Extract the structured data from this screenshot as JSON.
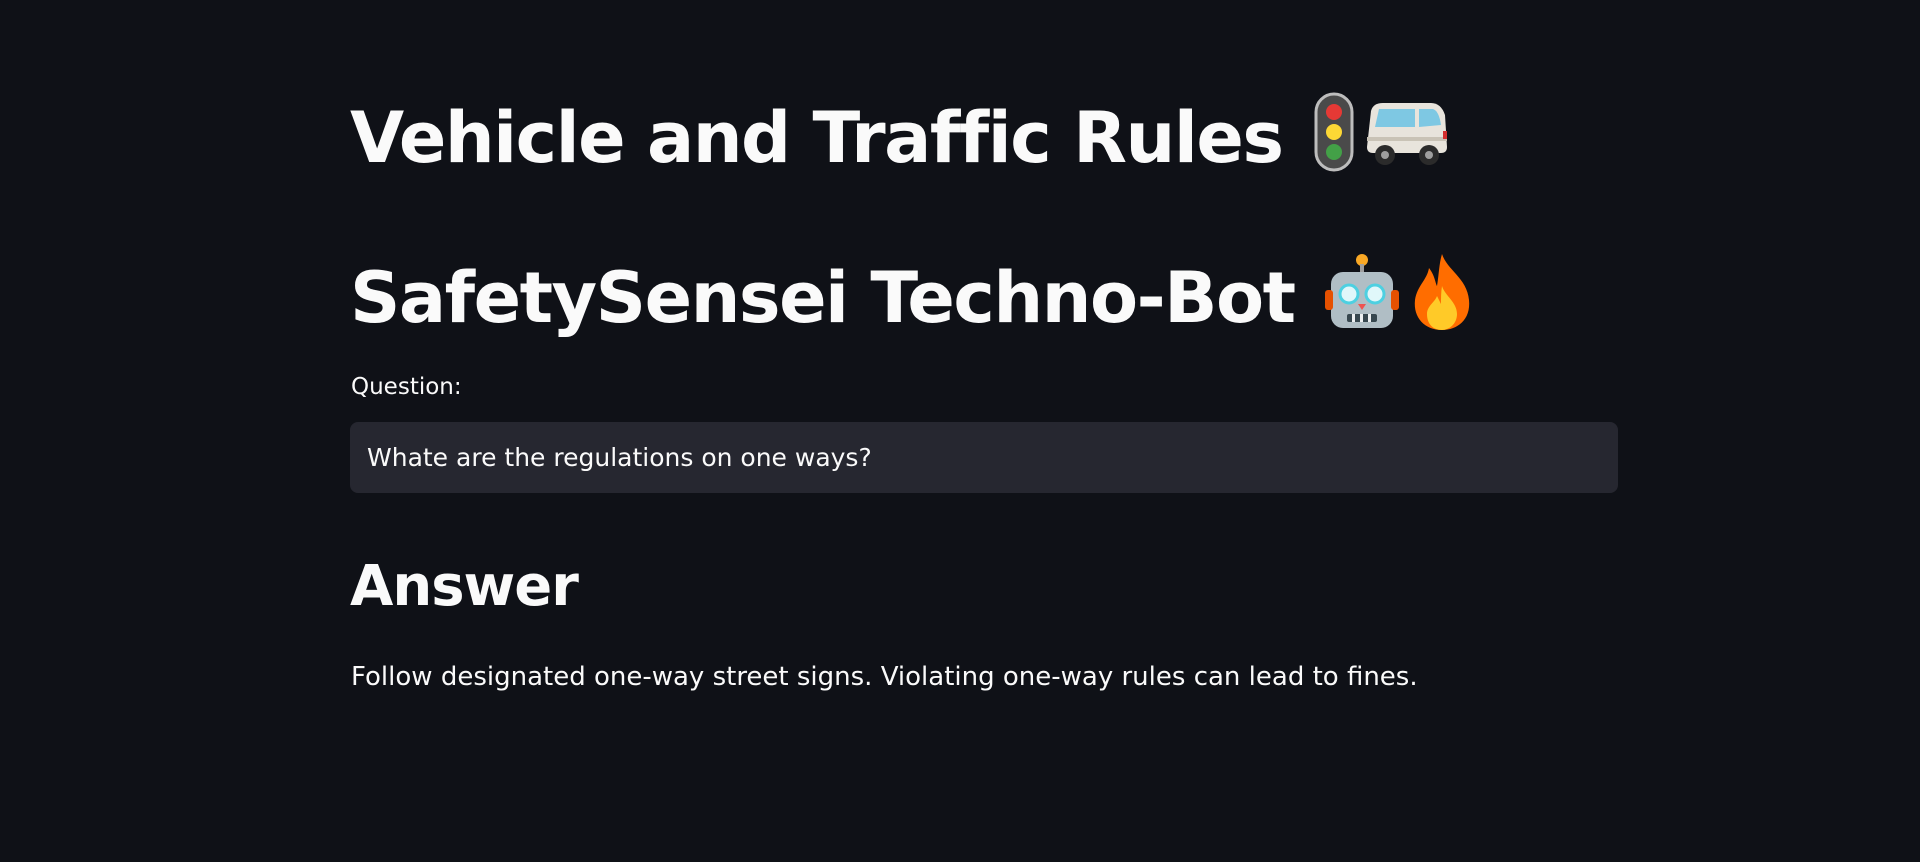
{
  "header": {
    "title": "Vehicle and Traffic Rules",
    "title_icons": [
      "traffic-light-icon",
      "minibus-icon"
    ],
    "subtitle": "SafetySensei Techno-Bot",
    "subtitle_icons": [
      "robot-icon",
      "fire-icon"
    ]
  },
  "question": {
    "label": "Question:",
    "value": "Whate are the regulations on one ways?"
  },
  "answer": {
    "heading": "Answer",
    "text": "Follow designated one-way street signs. Violating one-way rules can lead to fines."
  },
  "colors": {
    "background": "#0f1117",
    "input_background": "#262730",
    "text": "#fafafa"
  }
}
